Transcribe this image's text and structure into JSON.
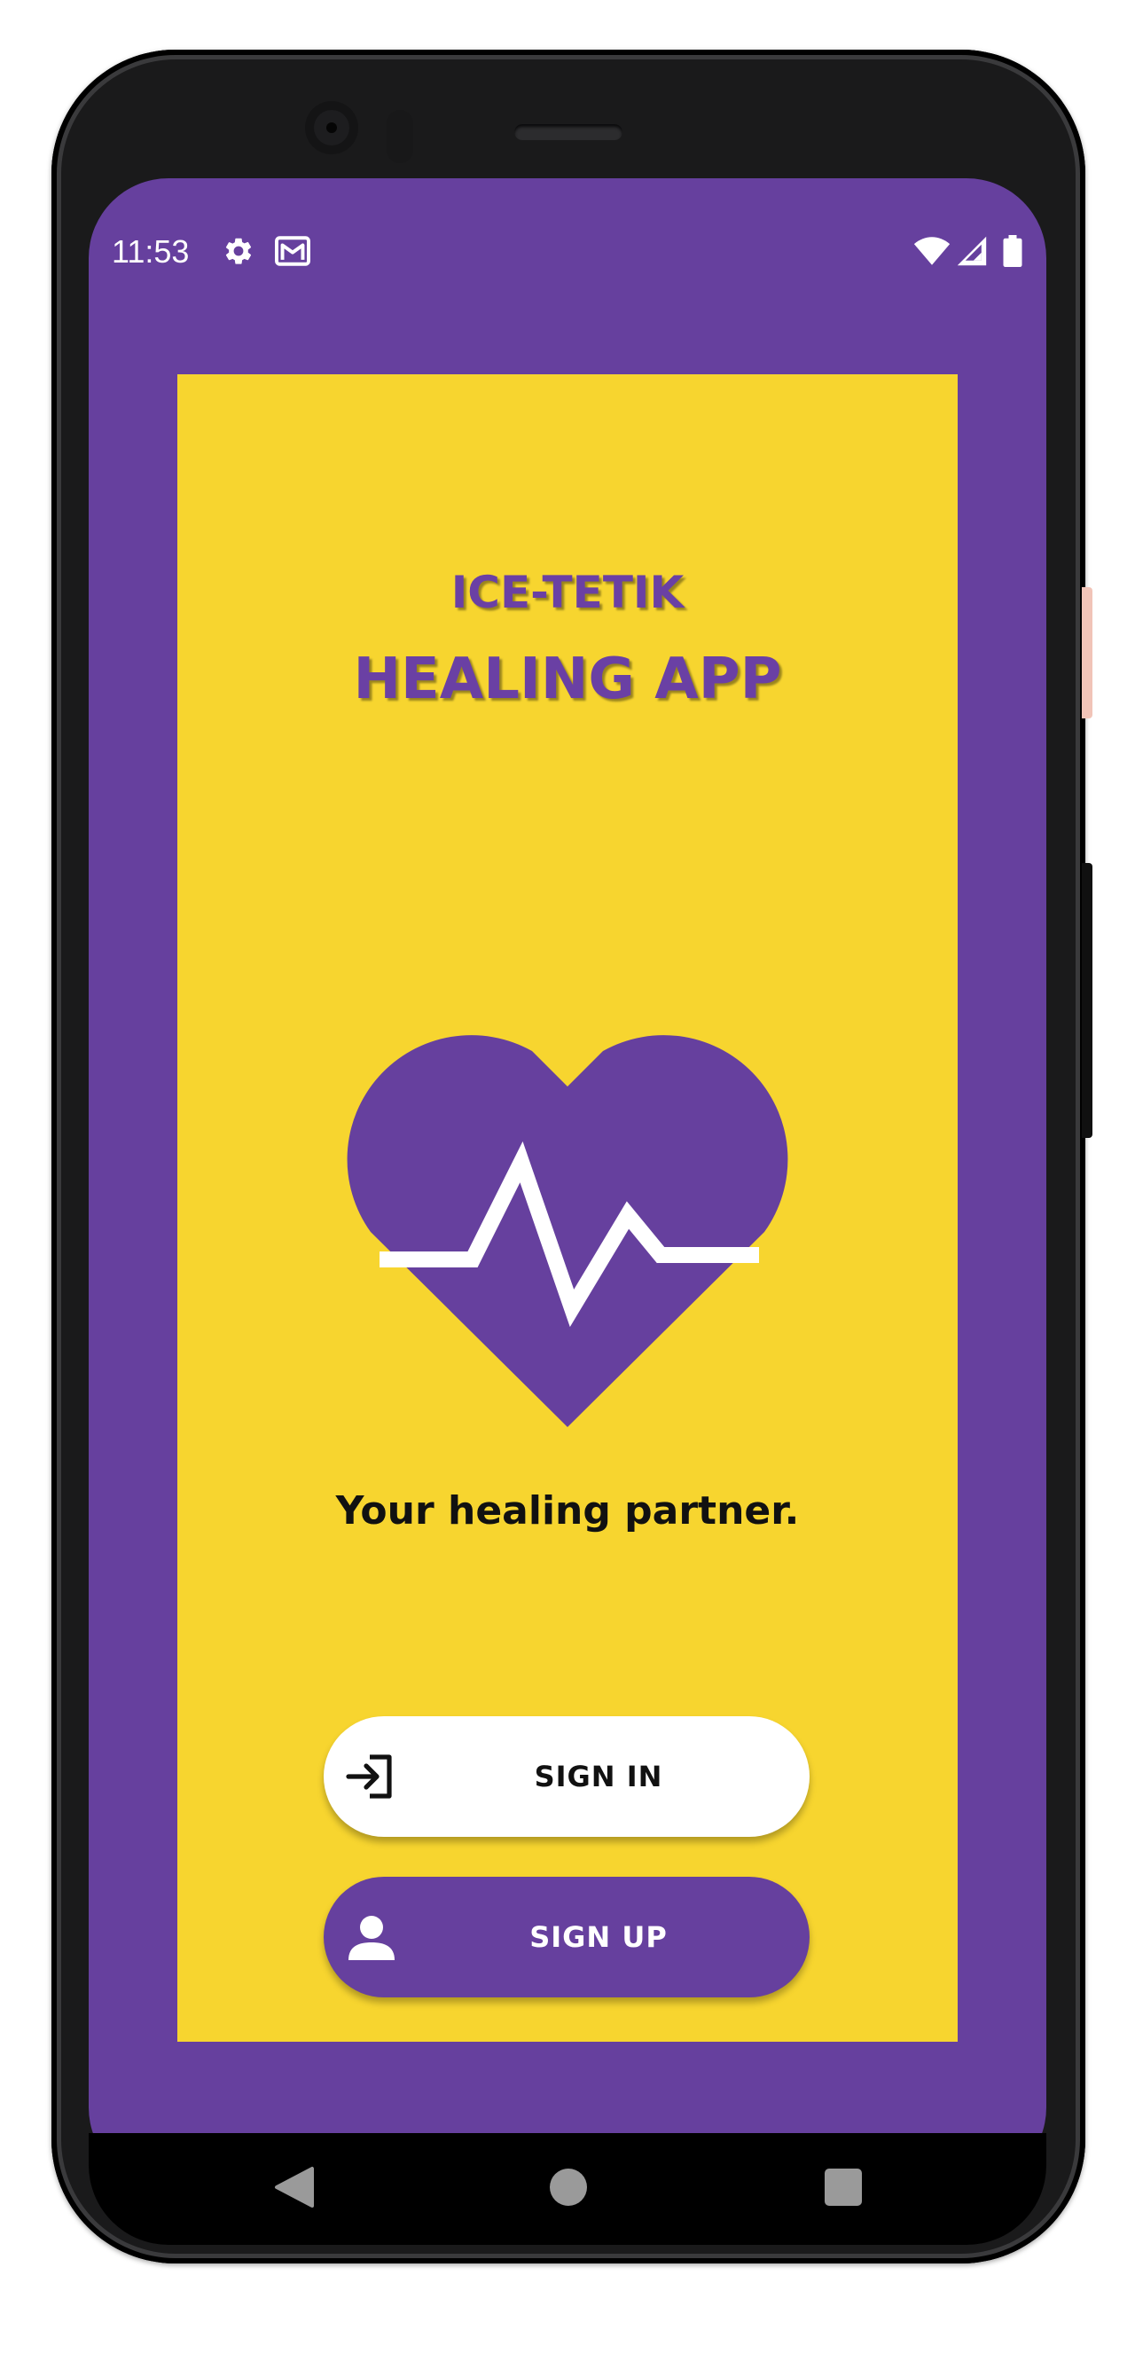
{
  "status_bar": {
    "time": "11:53",
    "left_icons": [
      "gear-icon",
      "gmail-icon"
    ],
    "right_icons": [
      "wifi-icon",
      "cell-signal-icon",
      "battery-icon"
    ]
  },
  "app": {
    "title_line1": "ICE-TETIK",
    "title_line2": "HEALING APP",
    "tagline": "Your healing partner.",
    "logo_icon": "heart-pulse-icon"
  },
  "buttons": {
    "sign_in": {
      "label": "SIGN IN",
      "icon": "login-icon"
    },
    "sign_up": {
      "label": "SIGN UP",
      "icon": "person-icon"
    }
  },
  "navigation": {
    "buttons": [
      "back-icon",
      "home-icon",
      "recents-icon"
    ]
  },
  "colors": {
    "primary_purple": "#66409E",
    "accent_yellow": "#F7D52F",
    "button_white": "#FFFFFF",
    "text_dark": "#111111"
  }
}
